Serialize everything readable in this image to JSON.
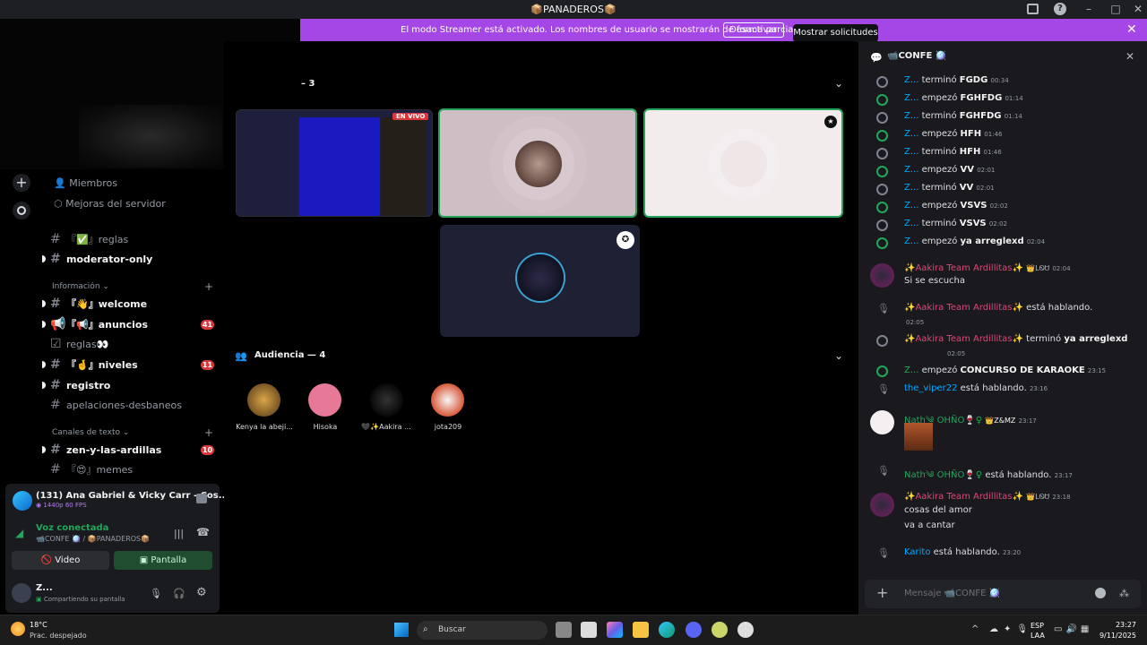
{
  "window": {
    "title": "📦PANADEROS📦"
  },
  "banner": {
    "text": "El modo Streamer está activado. Los nombres de usuario se mostrarán de forma parcial.",
    "button": "Desactivar",
    "tooltip": "Mostrar solicitudes"
  },
  "sidebar": {
    "members": "Miembros",
    "boosts": "Mejoras del servidor",
    "channels": [
      {
        "label": "『✅』reglas",
        "bright": false
      },
      {
        "label": "moderator-only",
        "bright": true
      },
      {
        "label": "『👋』welcome",
        "bright": true
      },
      {
        "label": "『📢』anuncios",
        "bright": true,
        "badge": "41"
      },
      {
        "label": "reglas👀",
        "bright": false
      },
      {
        "label": "『🤞』niveles",
        "bright": true,
        "badge": "11"
      },
      {
        "label": "registro",
        "bright": true
      },
      {
        "label": "apelaciones-desbaneos",
        "bright": false
      },
      {
        "label": "zen-y-las-ardillas",
        "bright": true,
        "badge": "10"
      },
      {
        "label": "『😍』memes",
        "bright": false
      }
    ],
    "cat_info": "Información",
    "cat_text": "Canales de texto"
  },
  "userpanel": {
    "activity_title": "(131) Ana Gabriel & Vicky Carr - Cos...",
    "activity_sub": "1440p 60 FPS",
    "voice_status": "Voz conectada",
    "voice_channel": "📹CONFE 🪩 / 📦PANADEROS📦",
    "video": "Video",
    "screen": "Pantalla",
    "username": "Z...",
    "user_status": "Compartiendo su pantalla"
  },
  "stage": {
    "speakers_count": "– 3",
    "live_badge": "EN VIVO",
    "audience_title": "Audiencia — 4",
    "audience": [
      {
        "name": "Kenya la abeji..."
      },
      {
        "name": "Hisoka"
      },
      {
        "name": "🖤✨Aakira ..."
      },
      {
        "name": "jota209"
      }
    ]
  },
  "chat": {
    "channel": "📹CONFE 🪩",
    "events": [
      {
        "user": "Z...",
        "verb": "terminó",
        "topic": "FGDG",
        "time": "00:34",
        "green": false
      },
      {
        "user": "Z...",
        "verb": "empezó",
        "topic": "FGHFDG",
        "time": "01:14",
        "green": true
      },
      {
        "user": "Z...",
        "verb": "terminó",
        "topic": "FGHFDG",
        "time": "01:14",
        "green": false
      },
      {
        "user": "Z...",
        "verb": "empezó",
        "topic": "HFH",
        "time": "01:46",
        "green": true
      },
      {
        "user": "Z...",
        "verb": "terminó",
        "topic": "HFH",
        "time": "01:46",
        "green": false
      },
      {
        "user": "Z...",
        "verb": "empezó",
        "topic": "VV",
        "time": "02:01",
        "green": true
      },
      {
        "user": "Z...",
        "verb": "terminó",
        "topic": "VV",
        "time": "02:01",
        "green": false
      },
      {
        "user": "Z...",
        "verb": "empezó",
        "topic": "VSVS",
        "time": "02:02",
        "green": true
      },
      {
        "user": "Z...",
        "verb": "terminó",
        "topic": "VSVS",
        "time": "02:02",
        "green": false
      },
      {
        "user": "Z...",
        "verb": "empezó",
        "topic": "ya arreglexd",
        "time": "02:04",
        "green": true
      }
    ],
    "aakira_name": "✨Aakira Team Ardillitas✨",
    "aakira_tag": "👑LᏫᏌ",
    "m1_time": "02:04",
    "m1_text": "Si se escucha",
    "speaking": "está hablando.",
    "m2_time": "02:05",
    "m3_verb": "terminó",
    "m3_topic": "ya arreglexd",
    "m3_time": "02:05",
    "m4_user": "Z...",
    "m4_verb": "empezó",
    "m4_topic": "CONCURSO DE KARAOKE",
    "m4_time": "23:15",
    "m5_user": "the_viper22",
    "m5_time": "23:16",
    "nath_name": "Nath༄ OHÑO🍷♀",
    "nath_tag": "👑Z&MZ",
    "m6_time": "23:17",
    "m7_time": "23:17",
    "m8_time": "23:18",
    "m8_line1": "cosas del amor",
    "m8_line2": "va a cantar",
    "m9_user": "Karito",
    "m9_time": "23:20",
    "input_placeholder": "Mensaje 📹CONFE 🪩"
  },
  "taskbar": {
    "weather_temp": "18°C",
    "weather_text": "Prac. despejado",
    "search": "Buscar",
    "lang1": "ESP",
    "lang2": "LAA",
    "time": "23:27",
    "date": "9/11/2025"
  },
  "colors": {
    "banner": "#a447e6",
    "accent_green": "#23a55a",
    "mention_red": "#da373c"
  }
}
